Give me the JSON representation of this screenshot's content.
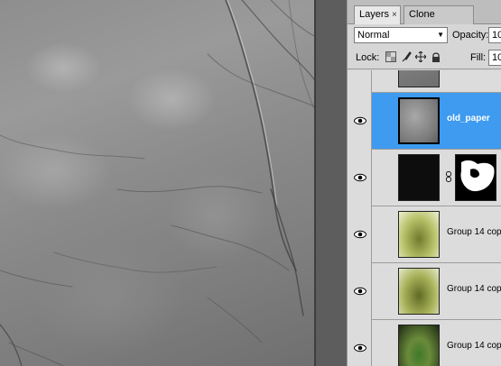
{
  "tabs": [
    {
      "label": "Layers",
      "close": "×"
    },
    {
      "label": "Clone Source"
    }
  ],
  "blend_mode": {
    "value": "Normal"
  },
  "opacity": {
    "label": "Opacity:",
    "value": "10"
  },
  "lock": {
    "label": "Lock:"
  },
  "fill": {
    "label": "Fill:",
    "value": "10"
  },
  "layers": [
    {
      "name": "",
      "visible": false,
      "selected": false,
      "partial": true
    },
    {
      "name": "old_paper",
      "visible": true,
      "selected": true
    },
    {
      "name": "",
      "visible": true,
      "selected": false,
      "has_mask": true
    },
    {
      "name": "Group 14 cop",
      "visible": true,
      "selected": false
    },
    {
      "name": "Group 14 cop",
      "visible": true,
      "selected": false
    },
    {
      "name": "Group 14 cop",
      "visible": true,
      "selected": false
    }
  ],
  "colors": {
    "selection": "#3e9bf0",
    "panel_bg": "#d4d4d4"
  }
}
